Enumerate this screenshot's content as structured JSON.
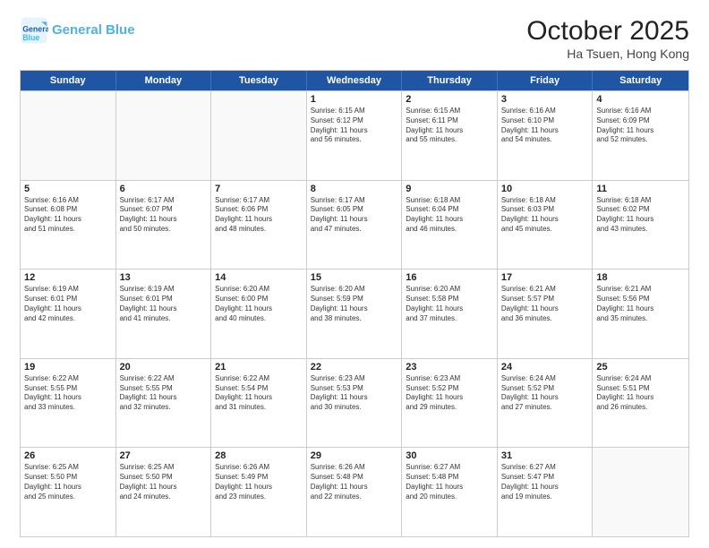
{
  "header": {
    "logo_line1": "General",
    "logo_line2": "Blue",
    "month": "October 2025",
    "location": "Ha Tsuen, Hong Kong"
  },
  "days": [
    "Sunday",
    "Monday",
    "Tuesday",
    "Wednesday",
    "Thursday",
    "Friday",
    "Saturday"
  ],
  "rows": [
    [
      {
        "day": "",
        "info": ""
      },
      {
        "day": "",
        "info": ""
      },
      {
        "day": "",
        "info": ""
      },
      {
        "day": "1",
        "info": "Sunrise: 6:15 AM\nSunset: 6:12 PM\nDaylight: 11 hours\nand 56 minutes."
      },
      {
        "day": "2",
        "info": "Sunrise: 6:15 AM\nSunset: 6:11 PM\nDaylight: 11 hours\nand 55 minutes."
      },
      {
        "day": "3",
        "info": "Sunrise: 6:16 AM\nSunset: 6:10 PM\nDaylight: 11 hours\nand 54 minutes."
      },
      {
        "day": "4",
        "info": "Sunrise: 6:16 AM\nSunset: 6:09 PM\nDaylight: 11 hours\nand 52 minutes."
      }
    ],
    [
      {
        "day": "5",
        "info": "Sunrise: 6:16 AM\nSunset: 6:08 PM\nDaylight: 11 hours\nand 51 minutes."
      },
      {
        "day": "6",
        "info": "Sunrise: 6:17 AM\nSunset: 6:07 PM\nDaylight: 11 hours\nand 50 minutes."
      },
      {
        "day": "7",
        "info": "Sunrise: 6:17 AM\nSunset: 6:06 PM\nDaylight: 11 hours\nand 48 minutes."
      },
      {
        "day": "8",
        "info": "Sunrise: 6:17 AM\nSunset: 6:05 PM\nDaylight: 11 hours\nand 47 minutes."
      },
      {
        "day": "9",
        "info": "Sunrise: 6:18 AM\nSunset: 6:04 PM\nDaylight: 11 hours\nand 46 minutes."
      },
      {
        "day": "10",
        "info": "Sunrise: 6:18 AM\nSunset: 6:03 PM\nDaylight: 11 hours\nand 45 minutes."
      },
      {
        "day": "11",
        "info": "Sunrise: 6:18 AM\nSunset: 6:02 PM\nDaylight: 11 hours\nand 43 minutes."
      }
    ],
    [
      {
        "day": "12",
        "info": "Sunrise: 6:19 AM\nSunset: 6:01 PM\nDaylight: 11 hours\nand 42 minutes."
      },
      {
        "day": "13",
        "info": "Sunrise: 6:19 AM\nSunset: 6:01 PM\nDaylight: 11 hours\nand 41 minutes."
      },
      {
        "day": "14",
        "info": "Sunrise: 6:20 AM\nSunset: 6:00 PM\nDaylight: 11 hours\nand 40 minutes."
      },
      {
        "day": "15",
        "info": "Sunrise: 6:20 AM\nSunset: 5:59 PM\nDaylight: 11 hours\nand 38 minutes."
      },
      {
        "day": "16",
        "info": "Sunrise: 6:20 AM\nSunset: 5:58 PM\nDaylight: 11 hours\nand 37 minutes."
      },
      {
        "day": "17",
        "info": "Sunrise: 6:21 AM\nSunset: 5:57 PM\nDaylight: 11 hours\nand 36 minutes."
      },
      {
        "day": "18",
        "info": "Sunrise: 6:21 AM\nSunset: 5:56 PM\nDaylight: 11 hours\nand 35 minutes."
      }
    ],
    [
      {
        "day": "19",
        "info": "Sunrise: 6:22 AM\nSunset: 5:55 PM\nDaylight: 11 hours\nand 33 minutes."
      },
      {
        "day": "20",
        "info": "Sunrise: 6:22 AM\nSunset: 5:55 PM\nDaylight: 11 hours\nand 32 minutes."
      },
      {
        "day": "21",
        "info": "Sunrise: 6:22 AM\nSunset: 5:54 PM\nDaylight: 11 hours\nand 31 minutes."
      },
      {
        "day": "22",
        "info": "Sunrise: 6:23 AM\nSunset: 5:53 PM\nDaylight: 11 hours\nand 30 minutes."
      },
      {
        "day": "23",
        "info": "Sunrise: 6:23 AM\nSunset: 5:52 PM\nDaylight: 11 hours\nand 29 minutes."
      },
      {
        "day": "24",
        "info": "Sunrise: 6:24 AM\nSunset: 5:52 PM\nDaylight: 11 hours\nand 27 minutes."
      },
      {
        "day": "25",
        "info": "Sunrise: 6:24 AM\nSunset: 5:51 PM\nDaylight: 11 hours\nand 26 minutes."
      }
    ],
    [
      {
        "day": "26",
        "info": "Sunrise: 6:25 AM\nSunset: 5:50 PM\nDaylight: 11 hours\nand 25 minutes."
      },
      {
        "day": "27",
        "info": "Sunrise: 6:25 AM\nSunset: 5:50 PM\nDaylight: 11 hours\nand 24 minutes."
      },
      {
        "day": "28",
        "info": "Sunrise: 6:26 AM\nSunset: 5:49 PM\nDaylight: 11 hours\nand 23 minutes."
      },
      {
        "day": "29",
        "info": "Sunrise: 6:26 AM\nSunset: 5:48 PM\nDaylight: 11 hours\nand 22 minutes."
      },
      {
        "day": "30",
        "info": "Sunrise: 6:27 AM\nSunset: 5:48 PM\nDaylight: 11 hours\nand 20 minutes."
      },
      {
        "day": "31",
        "info": "Sunrise: 6:27 AM\nSunset: 5:47 PM\nDaylight: 11 hours\nand 19 minutes."
      },
      {
        "day": "",
        "info": ""
      }
    ]
  ]
}
